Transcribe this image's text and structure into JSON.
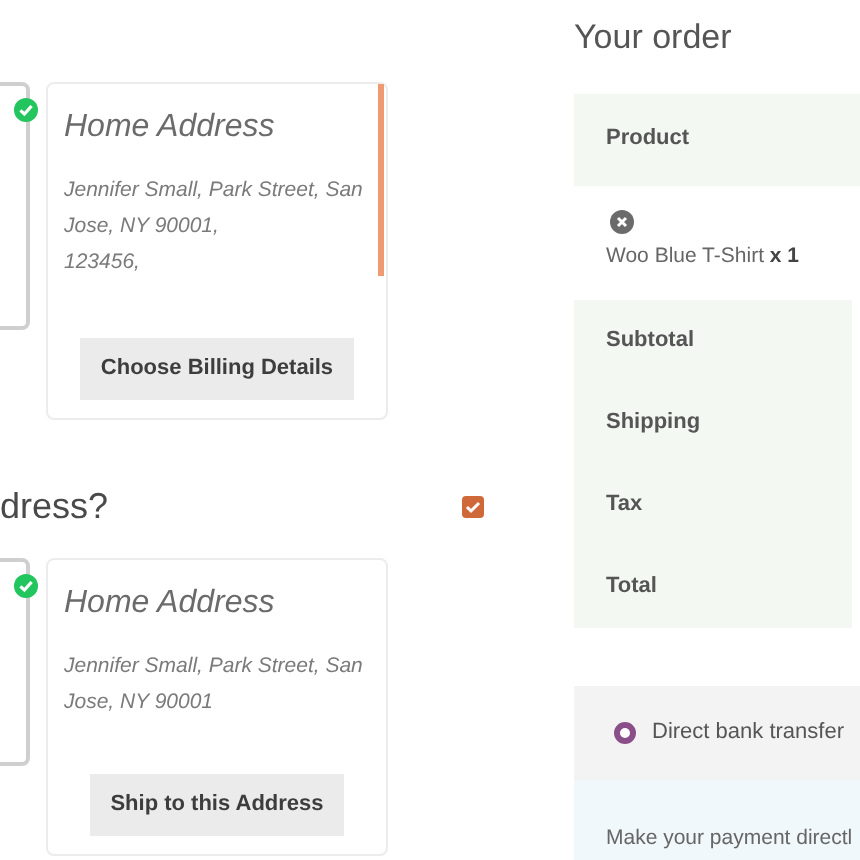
{
  "billing": {
    "cards": [
      {
        "kind": "partial",
        "selected": true
      },
      {
        "kind": "address",
        "title": "Home Address",
        "lines": [
          "Jennifer Small, Park Street, San Jose, NY 90001,",
          "123456,"
        ],
        "highlighted": true,
        "button": "Choose Billing Details"
      }
    ]
  },
  "shipping": {
    "heading": "dress?",
    "checked": true,
    "cards": [
      {
        "kind": "partial",
        "selected": true
      },
      {
        "kind": "address",
        "title": "Home Address",
        "lines": [
          "Jennifer Small, Park Street, San Jose, NY 90001"
        ],
        "highlighted": false,
        "button": "Ship to this Address"
      }
    ]
  },
  "order": {
    "title": "Your order",
    "header": "Product",
    "items": [
      {
        "name": "Woo Blue T-Shirt",
        "qty": "x 1"
      }
    ],
    "totals": [
      "Subtotal",
      "Shipping",
      "Tax",
      "Total"
    ]
  },
  "payment": {
    "methods": [
      {
        "label": "Direct bank transfer",
        "selected": true
      }
    ],
    "description": "Make your payment directl"
  }
}
